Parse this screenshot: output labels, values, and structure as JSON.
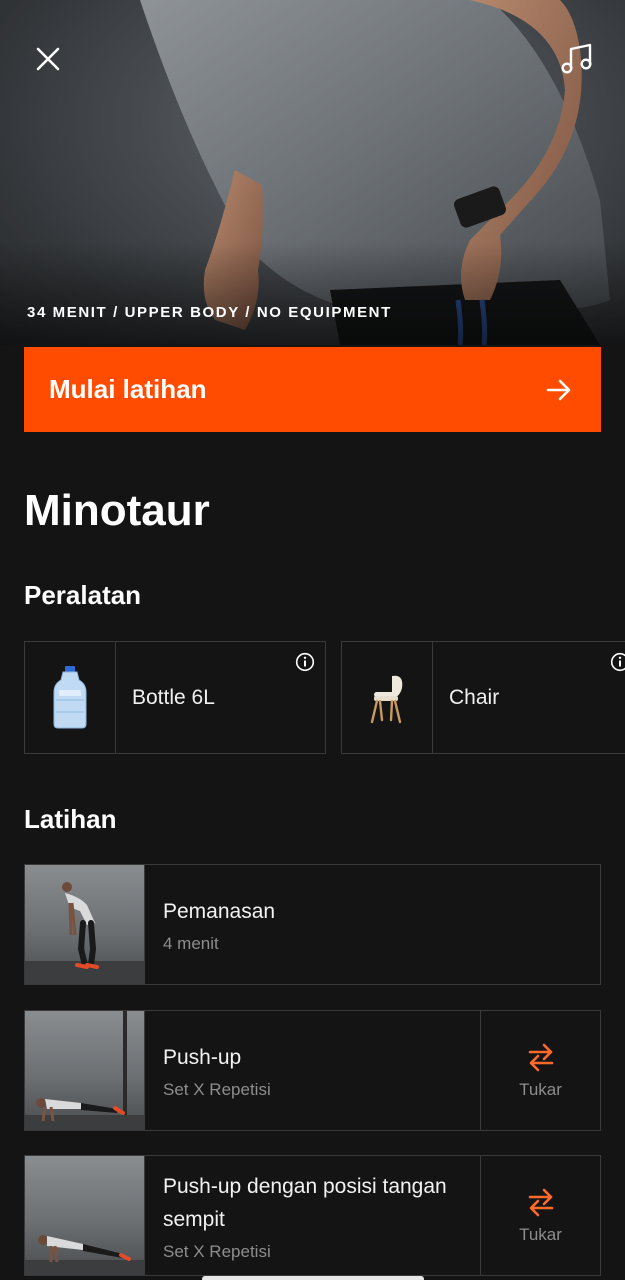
{
  "hero": {
    "meta": "34 MENIT / UPPER BODY / NO EQUIPMENT"
  },
  "cta": {
    "label": "Mulai latihan"
  },
  "workout": {
    "title": "Minotaur"
  },
  "equipment": {
    "heading": "Peralatan",
    "items": [
      {
        "name": "Bottle 6L",
        "icon": "water-bottle-icon"
      },
      {
        "name": "Chair",
        "icon": "chair-icon"
      }
    ]
  },
  "exercises": {
    "heading": "Latihan",
    "items": [
      {
        "name": "Pemanasan",
        "sub": "4 menit"
      },
      {
        "name": "Push-up",
        "sub": "Set X Repetisi",
        "swap": "Tukar"
      },
      {
        "name": "Push-up dengan posisi tangan sempit",
        "sub": "Set X Repetisi",
        "swap": "Tukar"
      }
    ]
  },
  "colors": {
    "accent": "#ff4c00",
    "background": "#141414",
    "border": "#3a3a3a",
    "muted_text": "#8d8d8d"
  }
}
